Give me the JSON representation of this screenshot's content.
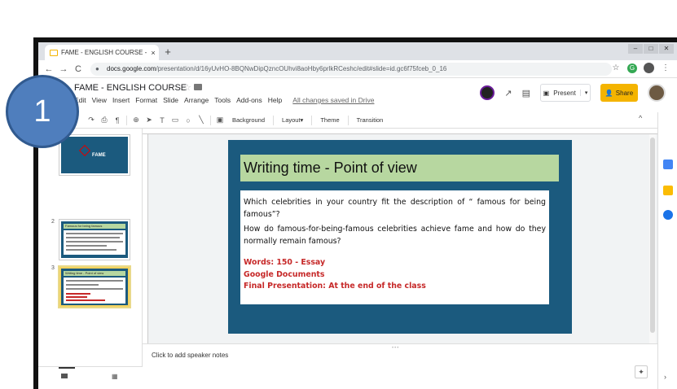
{
  "browser": {
    "tab_title": "FAME - ENGLISH COURSE - Goo",
    "tab_close": "×",
    "new_tab": "+",
    "url_domain": "docs.google.com",
    "url_path": "/presentation/d/16yUvHO-8BQNwDipQzncOUhvi8aoHby6prlkRCeshc/edit#slide=id.gc6f75fceb_0_16",
    "back": "←",
    "forward": "→",
    "reload": "C",
    "lock": "🔒",
    "star": "☆",
    "menu": "⋮"
  },
  "app": {
    "doc_title": "FAME - ENGLISH COURSE",
    "star": "☆",
    "menus": [
      "Edit",
      "View",
      "Insert",
      "Format",
      "Slide",
      "Arrange",
      "Tools",
      "Add-ons",
      "Help"
    ],
    "save_status": "All changes saved in Drive",
    "present_label": "Present",
    "present_caret": "▾",
    "share_label": "Share",
    "trend_icon": "↗",
    "comment_icon": "▤"
  },
  "toolbar": {
    "background_label": "Background",
    "layout_label": "Layout▾",
    "theme_label": "Theme",
    "transition_label": "Transition",
    "collapse": "^"
  },
  "filmstrip": {
    "slide_numbers": [
      "1",
      "2",
      "3"
    ],
    "thumb1_title": "FAME",
    "thumb1_text": "FAME thumbnail text",
    "thumb2_header": "Famous for being famous",
    "thumb3_header": "Writing time - Point of view"
  },
  "slide": {
    "title": "Writing time - Point of view",
    "question1": "Which celebrities in your country fit the description of “ famous for being famous”?",
    "question2": "How do famous-for-being-famous celebrities achieve fame and how do they normally remain famous?",
    "line_words": "Words: 150 - Essay",
    "line_docs": "Google Documents",
    "line_final": "Final Presentation: At the end of the class"
  },
  "notes": {
    "placeholder": "Click to add speaker notes",
    "grip": "•••"
  },
  "overlay": {
    "step_number": "1"
  },
  "colors": {
    "slide_bg": "#1b5a7e",
    "title_bar": "#b7d7a0",
    "accent_red": "#c62828",
    "share_yellow": "#f4b400",
    "badge_blue": "#4f7ebd"
  }
}
